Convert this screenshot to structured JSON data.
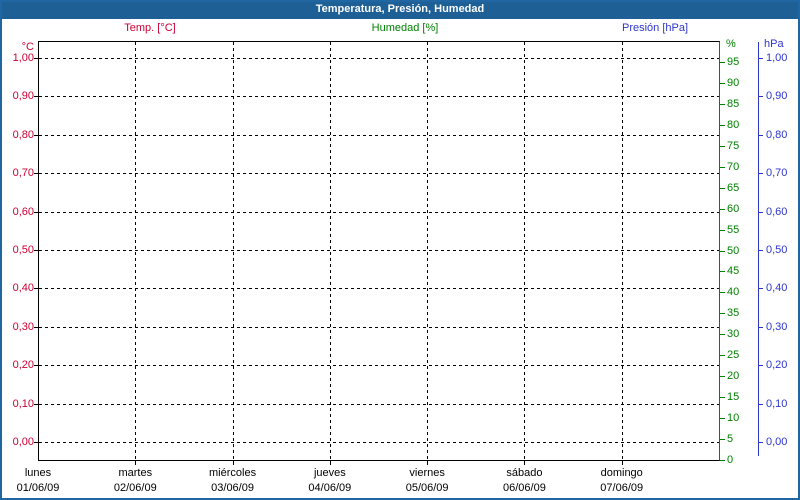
{
  "window": {
    "title": "Temperatura, Presión, Humedad",
    "titlebar_color": "#1e5f96",
    "border_color": "#2066a2",
    "background": "#ffffff"
  },
  "chart_data": {
    "type": "line",
    "title": "Temperatura, Presión, Humedad",
    "note": "empty chart - no data series plotted yet",
    "grid": {
      "style": "dashed",
      "color": "#000000"
    },
    "legend_position": "top",
    "series": [
      {
        "name": "Temp. [°C]",
        "color": "#cc0033",
        "axis": "left",
        "values": []
      },
      {
        "name": "Humedad [%]",
        "color": "#008200",
        "axis": "right_percent",
        "values": []
      },
      {
        "name": "Presión [hPa]",
        "color": "#2d35cc",
        "axis": "right_pressure",
        "values": []
      }
    ],
    "axes": {
      "left": {
        "unit": "°C",
        "color": "#cc0033",
        "min": 0.0,
        "max": 1.0,
        "tick_step": 0.1,
        "tick_labels": [
          "1,00",
          "0,90",
          "0,80",
          "0,70",
          "0,60",
          "0,50",
          "0,40",
          "0,30",
          "0,20",
          "0,10",
          "0,00"
        ]
      },
      "right_percent": {
        "unit": "%",
        "color": "#008200",
        "min": 0,
        "max": 100,
        "tick_step": 5,
        "tick_labels": [
          "95",
          "90",
          "85",
          "80",
          "75",
          "70",
          "65",
          "60",
          "55",
          "50",
          "45",
          "40",
          "35",
          "30",
          "25",
          "20",
          "15",
          "10",
          "5",
          "0"
        ]
      },
      "right_pressure": {
        "unit": "hPa",
        "color": "#2d35cc",
        "min": 0.0,
        "max": 1.0,
        "tick_step": 0.1,
        "tick_labels": [
          "1,00",
          "0,90",
          "0,80",
          "0,70",
          "0,60",
          "0,50",
          "0,40",
          "0,30",
          "0,20",
          "0,10",
          "0,00"
        ]
      },
      "x": {
        "days": [
          {
            "name": "lunes",
            "date": "01/06/09"
          },
          {
            "name": "martes",
            "date": "02/06/09"
          },
          {
            "name": "miércoles",
            "date": "03/06/09"
          },
          {
            "name": "jueves",
            "date": "04/06/09"
          },
          {
            "name": "viernes",
            "date": "05/06/09"
          },
          {
            "name": "sábado",
            "date": "06/06/09"
          },
          {
            "name": "domingo",
            "date": "07/06/09"
          }
        ]
      }
    }
  }
}
